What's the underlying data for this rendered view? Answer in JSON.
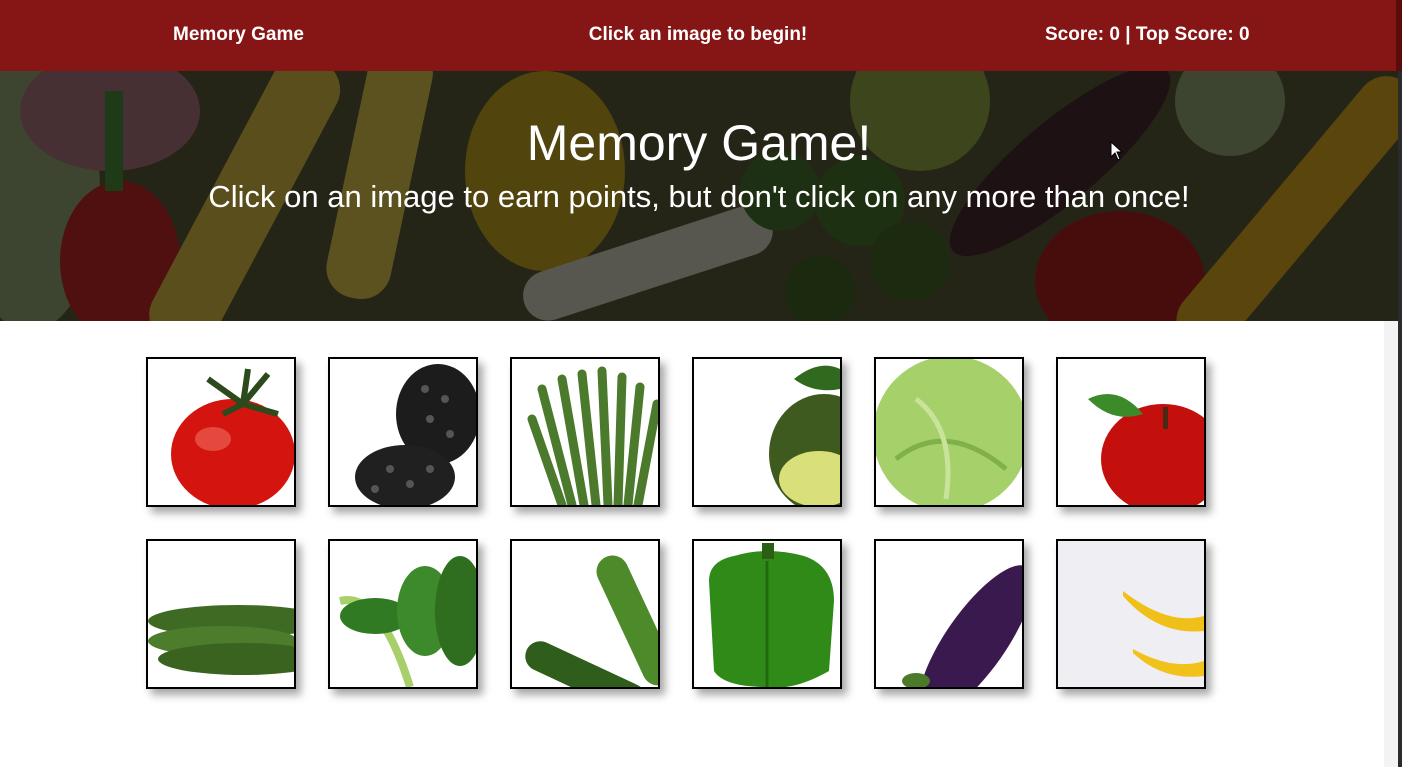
{
  "navbar": {
    "brand": "Memory Game",
    "message": "Click an image to begin!",
    "score_label": "Score: 0 | Top Score: 0",
    "background": "#861616"
  },
  "hero": {
    "title": "Memory Game!",
    "subtitle": "Click on an image to earn points, but don't click on any more than once!"
  },
  "cards": [
    {
      "name": "tomato",
      "icon": "tomato-image"
    },
    {
      "name": "blackberry",
      "icon": "blackberry-image"
    },
    {
      "name": "asparagus",
      "icon": "asparagus-image"
    },
    {
      "name": "avocado",
      "icon": "avocado-image"
    },
    {
      "name": "cabbage",
      "icon": "cabbage-image"
    },
    {
      "name": "apple",
      "icon": "apple-image"
    },
    {
      "name": "cucumber",
      "icon": "cucumber-image"
    },
    {
      "name": "bok choy",
      "icon": "bok-choy-image"
    },
    {
      "name": "zucchini",
      "icon": "zucchini-image"
    },
    {
      "name": "green pepper",
      "icon": "green-pepper-image"
    },
    {
      "name": "eggplant",
      "icon": "eggplant-image"
    },
    {
      "name": "banana",
      "icon": "banana-image"
    }
  ]
}
